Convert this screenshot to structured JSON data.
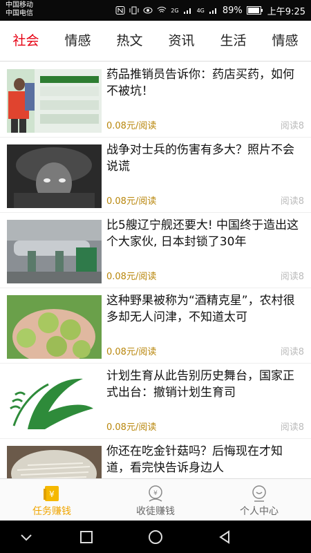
{
  "status": {
    "carrier1": "中国移动",
    "carrier2": "中国电信",
    "battery": "89%",
    "time": "上午9:25",
    "net1": "2G",
    "net2": "4G"
  },
  "tabs": [
    {
      "label": "社会"
    },
    {
      "label": "情感"
    },
    {
      "label": "热文"
    },
    {
      "label": "资讯"
    },
    {
      "label": "生活"
    },
    {
      "label": "情感"
    }
  ],
  "articles": [
    {
      "title": "药品推销员告诉你：药店买药，如何不被坑！",
      "price": "0.08元/阅读",
      "reads": "阅读8"
    },
    {
      "title": "战争对士兵的伤害有多大？照片不会说谎",
      "price": "0.08元/阅读",
      "reads": "阅读8"
    },
    {
      "title": "比5艘辽宁舰还要大! 中国终于造出这个大家伙, 日本封锁了30年",
      "price": "0.08元/阅读",
      "reads": "阅读8"
    },
    {
      "title": "这种野果被称为“酒精克星”，农村很多却无人问津，不知道太可",
      "price": "0.08元/阅读",
      "reads": "阅读8"
    },
    {
      "title": "计划生育从此告别历史舞台，国家正式出台：撤销计划生育司",
      "price": "0.08元/阅读",
      "reads": "阅读8"
    },
    {
      "title": "你还在吃金针菇吗？后悔现在才知道，看完快告诉身边人",
      "price": "",
      "reads": ""
    }
  ],
  "bottom_nav": [
    {
      "label": "任务赚钱"
    },
    {
      "label": "收徒赚钱"
    },
    {
      "label": "个人中心"
    }
  ],
  "colors": {
    "active_tab": "#e60012",
    "active_nav": "#f0a500",
    "price": "#b8860b"
  }
}
